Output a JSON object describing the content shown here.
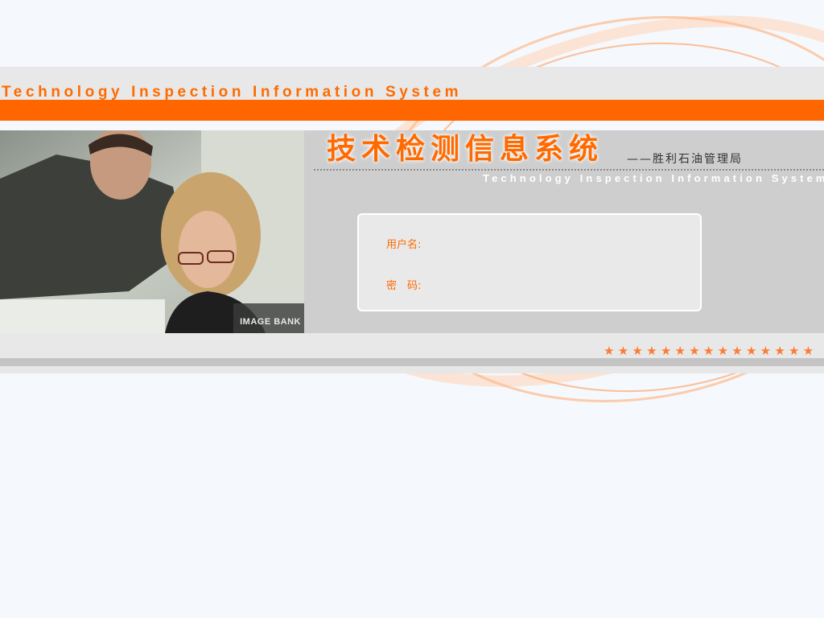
{
  "header": {
    "title_en": "Technology Inspection Information System"
  },
  "banner": {
    "title_cn": "技术检测信息系统",
    "subtitle_cn": "——胜利石油管理局",
    "title_en": "Technology Inspection Information System",
    "photo_watermark": "IMAGE BANK"
  },
  "login": {
    "username_label": "用户名:",
    "username_value": "",
    "password_label": "密　码:",
    "password_value": ""
  },
  "decoration": {
    "star_count": 15,
    "star_icon": "star-icon",
    "accent_color": "#ff6600",
    "band_color": "#e8e8e8"
  }
}
